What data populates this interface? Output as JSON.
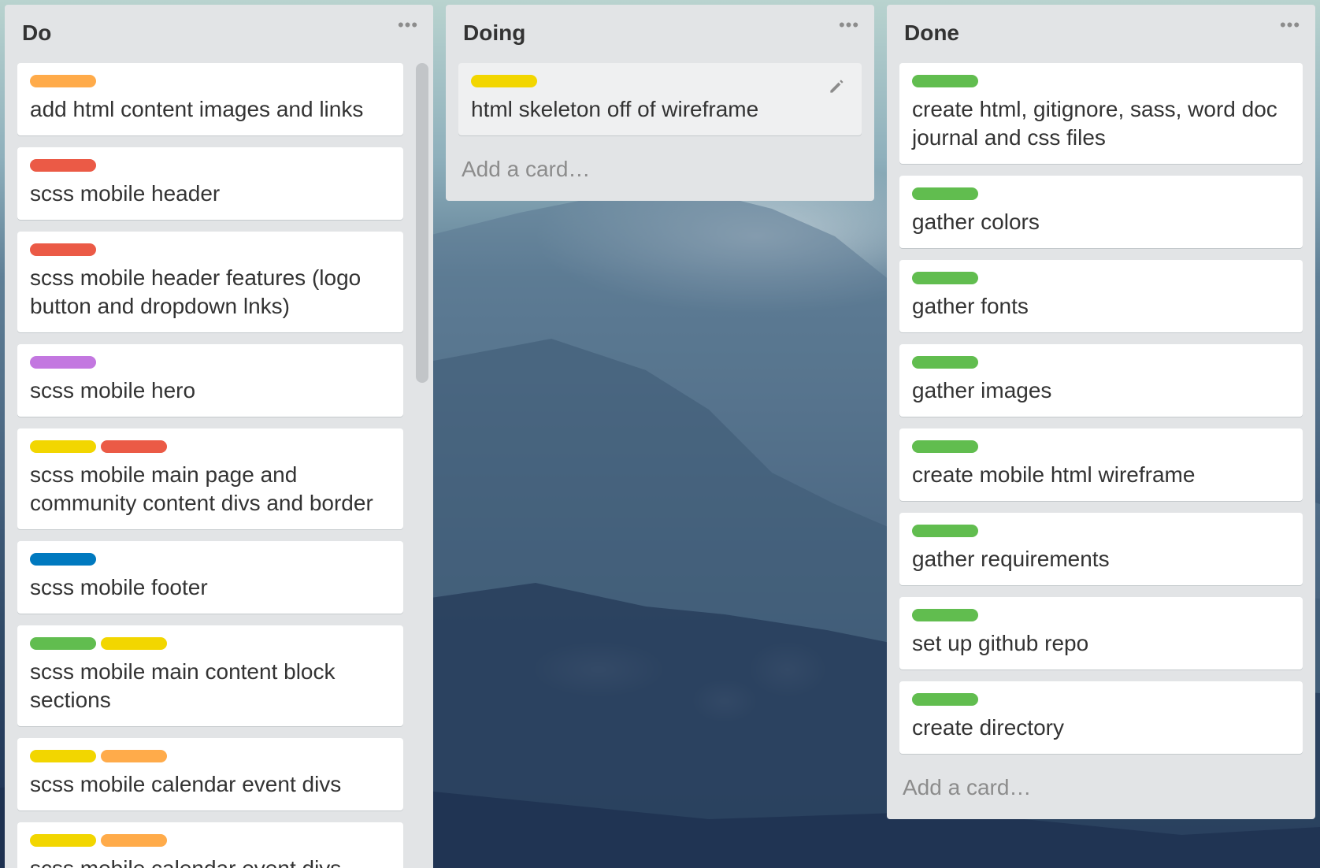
{
  "colors": {
    "orange": "#ffab4a",
    "red": "#eb5a46",
    "purple": "#c377e0",
    "yellow": "#f2d600",
    "blue": "#0079bf",
    "green": "#61bd4f"
  },
  "lists": [
    {
      "title": "Do",
      "menu_icon": "more-horizontal-icon",
      "cards": [
        {
          "labels": [
            "orange"
          ],
          "title": "add html content images and links"
        },
        {
          "labels": [
            "red"
          ],
          "title": "scss mobile header"
        },
        {
          "labels": [
            "red"
          ],
          "title": "scss mobile header features (logo button and dropdown lnks)"
        },
        {
          "labels": [
            "purple"
          ],
          "title": "scss mobile hero"
        },
        {
          "labels": [
            "yellow",
            "red"
          ],
          "title": "scss mobile main page and community content divs and border"
        },
        {
          "labels": [
            "blue"
          ],
          "title": "scss mobile footer"
        },
        {
          "labels": [
            "green",
            "yellow"
          ],
          "title": "scss mobile main content block sections"
        },
        {
          "labels": [
            "yellow",
            "orange"
          ],
          "title": "scss mobile calendar event divs"
        },
        {
          "labels": [
            "yellow",
            "orange"
          ],
          "title": "scss mobile calendar event divs"
        }
      ]
    },
    {
      "title": "Doing",
      "menu_icon": "more-horizontal-icon",
      "cards": [
        {
          "labels": [
            "yellow"
          ],
          "title": "html skeleton off of wireframe",
          "edit_icon": "pencil-icon"
        }
      ],
      "add_card": "Add a card…"
    },
    {
      "title": "Done",
      "menu_icon": "more-horizontal-icon",
      "cards": [
        {
          "labels": [
            "green"
          ],
          "title": "create html, gitignore, sass, word doc journal and css files"
        },
        {
          "labels": [
            "green"
          ],
          "title": "gather colors"
        },
        {
          "labels": [
            "green"
          ],
          "title": "gather fonts"
        },
        {
          "labels": [
            "green"
          ],
          "title": "gather images"
        },
        {
          "labels": [
            "green"
          ],
          "title": "create mobile html wireframe"
        },
        {
          "labels": [
            "green"
          ],
          "title": "gather requirements"
        },
        {
          "labels": [
            "green"
          ],
          "title": "set up github repo"
        },
        {
          "labels": [
            "green"
          ],
          "title": "create directory"
        }
      ],
      "add_card": "Add a card…"
    }
  ]
}
